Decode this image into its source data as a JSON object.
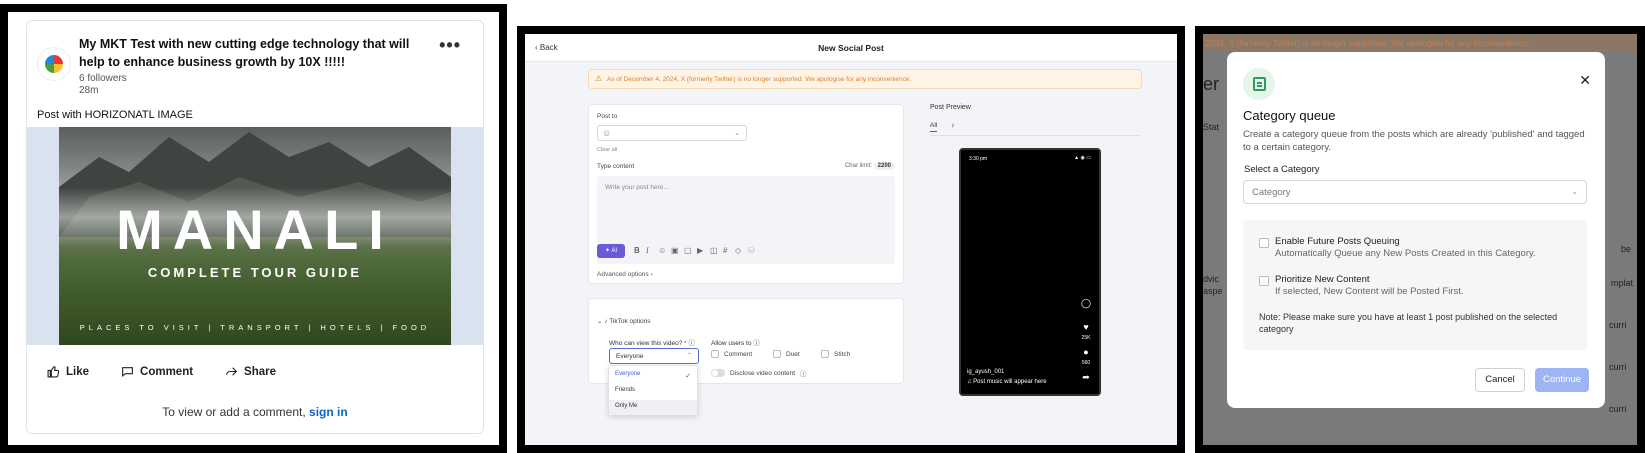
{
  "post": {
    "title": "My MKT Test with new cutting edge technology that will help to enhance business growth by 10X !!!!!",
    "followers": "6 followers",
    "time": "28m",
    "more": "•••",
    "caption": "Post with HORIZONATL IMAGE",
    "image": {
      "title": "MANALI",
      "subtitle": "COMPLETE TOUR GUIDE",
      "footer": "PLACES TO VISIT | TRANSPORT | HOTELS | FOOD"
    },
    "actions": {
      "like": "Like",
      "comment": "Comment",
      "share": "Share"
    },
    "comment_prompt": "To view or add a comment,",
    "sign_in": "sign in"
  },
  "new_post": {
    "back": "Back",
    "title": "New Social Post",
    "warning": "As of December 4, 2024, X (formerly Twitter) is no longer supported. We apologise for any inconvenience.",
    "post_to_label": "Post to",
    "clear_all": "Clear all",
    "type_content_label": "Type content",
    "char_limit_label": "Char limit:",
    "char_limit_value": "2200",
    "content_placeholder": "Write your post here...",
    "ai_label": "AI",
    "advanced_options": "Advanced options",
    "tiktok_options": "TikTok options",
    "who_can_view": "Who can view this video?",
    "required_mark": "*",
    "selected_visibility": "Everyone",
    "visibility_options": [
      "Everyone",
      "Friends",
      "Only Me"
    ],
    "allow_users": "Allow users to",
    "allow_options": [
      "Comment",
      "Duet",
      "Stitch"
    ],
    "disclose": "Disclose video content",
    "preview_label": "Post Preview",
    "preview_tab_all": "All",
    "phone": {
      "time": "3:30 pm",
      "likes": "25K",
      "comments": "560",
      "username": "ig_ayush_001",
      "music": "Post music will appear here"
    }
  },
  "category_queue": {
    "bg_warning": "2024, X (formerly Twitter) is no longer supported. We apologise for any inconvenience.",
    "bg_fragments": [
      "er",
      "Stat",
      "dvic",
      "aspe",
      "be",
      "mplat",
      "curri",
      "curri",
      "curri"
    ],
    "title": "Category queue",
    "description": "Create a category queue from the posts which are already 'published' and tagged to a certain category.",
    "select_label": "Select a Category",
    "select_placeholder": "Category",
    "option1_title": "Enable Future Posts Queuing",
    "option1_desc": "Automatically Queue any New Posts Created in this Category.",
    "option2_title": "Prioritize New Content",
    "option2_desc": "If selected, New Content will be Posted First.",
    "note": "Note: Please make sure you have at least 1 post published on the selected category",
    "cancel": "Cancel",
    "continue": "Continue"
  }
}
